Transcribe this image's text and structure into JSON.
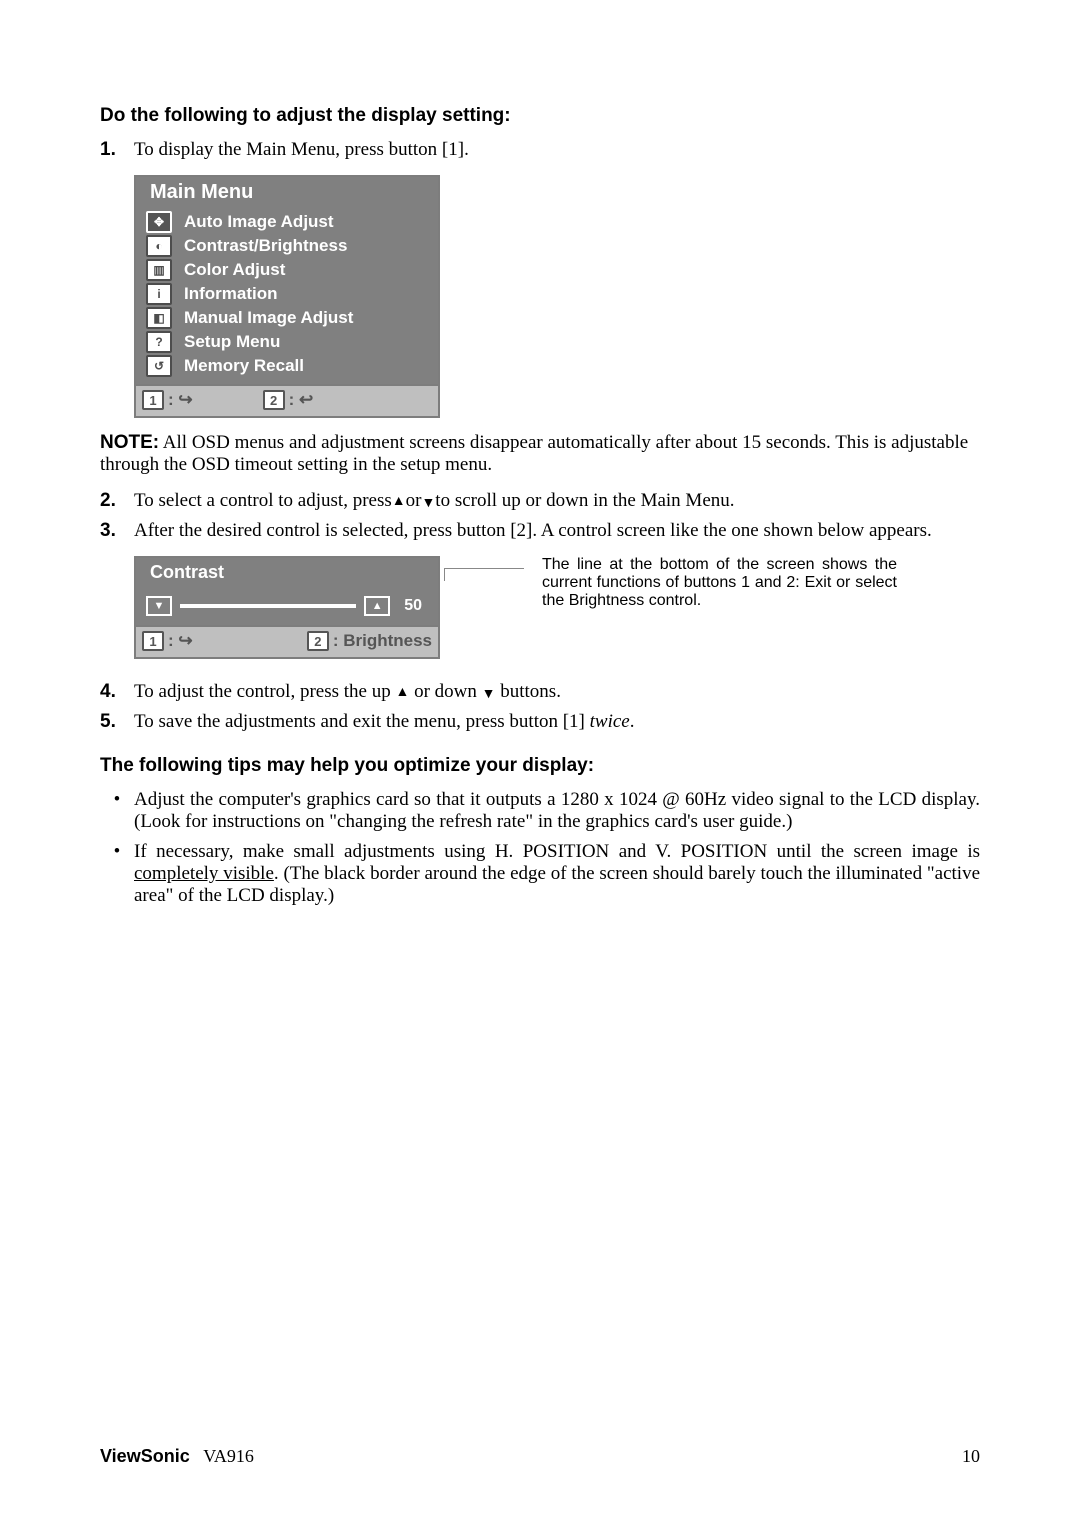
{
  "sec1_heading": "Do the following to adjust the display setting:",
  "step1_num": "1.",
  "step1_text": "To display the Main Menu, press button [1].",
  "osd_main": {
    "title": "Main Menu",
    "items": [
      {
        "icon": "✥",
        "label": "Auto Image Adjust",
        "sel": true
      },
      {
        "icon": "◐",
        "label": "Contrast/Brightness",
        "sel": false
      },
      {
        "icon": "▥",
        "label": "Color Adjust",
        "sel": false
      },
      {
        "icon": "i",
        "label": "Information",
        "sel": false
      },
      {
        "icon": "◧",
        "label": "Manual Image Adjust",
        "sel": false
      },
      {
        "icon": "?",
        "label": "Setup Menu",
        "sel": false
      },
      {
        "icon": "↺",
        "label": "Memory Recall",
        "sel": false
      }
    ],
    "foot1_key": "1",
    "foot1_sym": ": ↪",
    "foot2_key": "2",
    "foot2_sym": ": ↩"
  },
  "note_label": "NOTE:",
  "note_text": " All OSD menus and adjustment screens disappear automatically after about 15 seconds. This is adjustable through the OSD timeout setting in the setup menu.",
  "step2_num": "2.",
  "step2_pre": "To select a control to adjust, press",
  "step2_up": "▲",
  "step2_mid": "or",
  "step2_dn": "▼",
  "step2_post": "to scroll up or down in the Main Menu.",
  "step3_num": "3.",
  "step3_text": "After the desired control is selected, press button [2]. A control screen like the one shown below appears.",
  "osd_contrast": {
    "title": "Contrast",
    "value": "50",
    "foot1_key": "1",
    "foot1_sym": ": ↪",
    "foot2_key": "2",
    "foot2_label": ": Brightness"
  },
  "callout_text": "The line at the bottom of the screen shows the current functions of buttons 1 and 2: Exit or select the Brightness control.",
  "step4_num": "4.",
  "step4_pre": "To adjust the control, press the up ",
  "step4_up": "▲",
  "step4_mid": " or down ",
  "step4_dn": "▼",
  "step4_post": " buttons.",
  "step5_num": "5.",
  "step5_pre": "To save the adjustments and exit the menu, press button [1] ",
  "step5_twice": "twice",
  "step5_post": ".",
  "sec2_heading": "The following tips may help you optimize your display:",
  "tip1": "Adjust the computer's graphics card so that it outputs a 1280 x 1024 @ 60Hz video signal to the LCD display. (Look for instructions on \"changing the refresh rate\" in the graphics card's user guide.)",
  "tip2_pre": "If necessary, make small adjustments using H. POSITION and V. POSITION until the screen image is ",
  "tip2_und": "completely visible",
  "tip2_post": ". (The black border around the edge of the screen should barely touch the illuminated \"active area\" of the LCD display.)",
  "footer_brand": "ViewSonic",
  "footer_model": "VA916",
  "footer_page": "10"
}
